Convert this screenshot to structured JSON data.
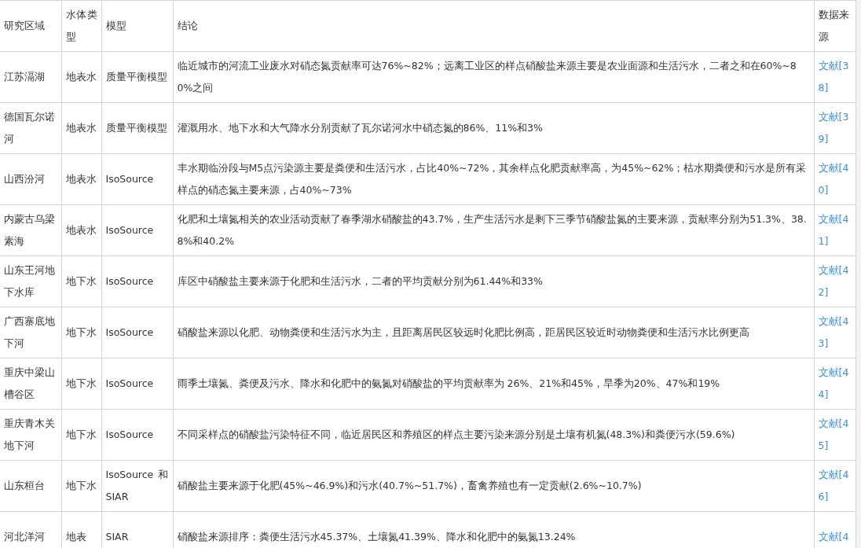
{
  "table": {
    "columns": [
      "研究区域",
      "水体类型",
      "模型",
      "结论",
      "数据来源"
    ],
    "rows": [
      {
        "region": "江苏滆湖",
        "water_type": "地表水",
        "model": "质量平衡模型",
        "conclusion": "临近城市的河流工业废水对硝态氮贡献率可达76%~82%；远离工业区的样点硝酸盐来源主要是农业面源和生活污水，二者之和在60%~80%之间",
        "source": "文献[38]"
      },
      {
        "region": "德国瓦尔诺河",
        "water_type": "地表水",
        "model": "质量平衡模型",
        "conclusion": "灌溉用水、地下水和大气降水分别贡献了瓦尔诺河水中硝态氮的86%、11%和3%",
        "source": "文献[39]"
      },
      {
        "region": "山西汾河",
        "water_type": "地表水",
        "model": "IsoSource",
        "conclusion": "丰水期临汾段与M5点污染源主要是粪便和生活污水，占比40%~72%，其余样点化肥贡献率高，为45%~62%；枯水期粪便和污水是所有采样点的硝态氮主要来源，占40%~73%",
        "source": "文献[40]"
      },
      {
        "region": "内蒙古乌梁素海",
        "water_type": "地表水",
        "model": "IsoSource",
        "conclusion": "化肥和土壤氮相关的农业活动贡献了春季湖水硝酸盐的43.7%，生产生活污水是剩下三季节硝酸盐氮的主要来源，贡献率分别为51.3%、38.8%和40.2%",
        "source": "文献[41]"
      },
      {
        "region": "山东王河地下水库",
        "water_type": "地下水",
        "model": "IsoSource",
        "conclusion": "库区中硝酸盐主要来源于化肥和生活污水，二者的平均贡献分别为61.44%和33%",
        "source": "文献[42]"
      },
      {
        "region": "广西寨底地下河",
        "water_type": "地下水",
        "model": "IsoSource",
        "conclusion": "硝酸盐来源以化肥、动物粪便和生活污水为主，且距离居民区较远时化肥比例高，距居民区较近时动物粪便和生活污水比例更高",
        "source": "文献[43]"
      },
      {
        "region": "重庆中梁山槽谷区",
        "water_type": "地下水",
        "model": "IsoSource",
        "conclusion": "雨季土壤氮、粪便及污水、降水和化肥中的氨氮对硝酸盐的平均贡献率为 26%、21%和45%，旱季为20%、47%和19%",
        "source": "文献[44]"
      },
      {
        "region": "重庆青木关地下河",
        "water_type": "地下水",
        "model": "IsoSource",
        "conclusion": "不同采样点的硝酸盐污染特征不同，临近居民区和养殖区的样点主要污染来源分别是土壤有机氮(48.3%)和粪便污水(59.6%)",
        "source": "文献[45]"
      },
      {
        "region": "山东桓台",
        "water_type": "地下水",
        "model": "IsoSource 和 SIAR",
        "conclusion": "硝酸盐主要来源于化肥(45%~46.9%)和污水(40.7%~51.7%)，畜禽养殖也有一定贡献(2.6%~10.7%)",
        "source": "文献[46]"
      },
      {
        "region": "河北洋河",
        "water_type": "地表",
        "model": "SIAR",
        "conclusion": "硝酸盐来源排序：粪便生活污水45.37%、土壤氮41.39%、降水和化肥中的氨氮13.24%",
        "source": "文献[4"
      }
    ]
  }
}
